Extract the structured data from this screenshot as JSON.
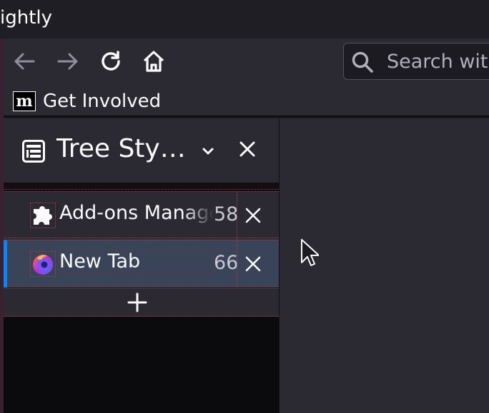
{
  "window": {
    "title": "ightly"
  },
  "toolbar": {
    "back": "back-arrow-icon",
    "forward": "forward-arrow-icon",
    "reload": "reload-icon",
    "home": "home-icon",
    "search_placeholder": "Search wit"
  },
  "bookmarks": {
    "items": [
      {
        "favicon": "m",
        "label": "Get Involved"
      }
    ]
  },
  "sidebar": {
    "title": "Tree Sty…",
    "tabs": [
      {
        "label": "Add-ons Manager",
        "count": "58",
        "icon": "puzzle-piece-icon"
      },
      {
        "label": "New Tab",
        "count": "66",
        "icon": "firefox-logo-icon",
        "active": true
      }
    ]
  },
  "colors": {
    "accent": "#0a84ff",
    "toolbar_bg": "#2b2a33",
    "active_tab_bg": "#3a4458",
    "titlebar_bg": "#1f1e25"
  }
}
